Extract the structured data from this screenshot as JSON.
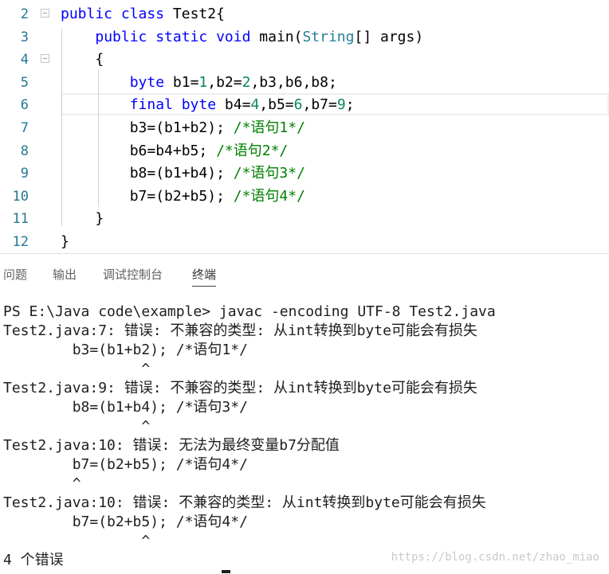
{
  "editor": {
    "lines": [
      {
        "num": "2",
        "tokens": [
          {
            "t": "public class ",
            "c": "kw"
          },
          {
            "t": "Test2{",
            "c": ""
          }
        ]
      },
      {
        "num": "3",
        "tokens": [
          {
            "t": "    ",
            "c": ""
          },
          {
            "t": "public static void ",
            "c": "kw"
          },
          {
            "t": "main(",
            "c": ""
          },
          {
            "t": "String",
            "c": "ty"
          },
          {
            "t": "[] args)",
            "c": ""
          }
        ]
      },
      {
        "num": "4",
        "tokens": [
          {
            "t": "    {",
            "c": ""
          }
        ]
      },
      {
        "num": "5",
        "tokens": [
          {
            "t": "        ",
            "c": ""
          },
          {
            "t": "byte ",
            "c": "kw"
          },
          {
            "t": "b1=",
            "c": ""
          },
          {
            "t": "1",
            "c": "num"
          },
          {
            "t": ",b2=",
            "c": ""
          },
          {
            "t": "2",
            "c": "num"
          },
          {
            "t": ",b3,b6,b8;",
            "c": ""
          }
        ]
      },
      {
        "num": "6",
        "tokens": [
          {
            "t": "        ",
            "c": ""
          },
          {
            "t": "final byte ",
            "c": "kw"
          },
          {
            "t": "b4=",
            "c": ""
          },
          {
            "t": "4",
            "c": "num"
          },
          {
            "t": ",b5=",
            "c": ""
          },
          {
            "t": "6",
            "c": "num"
          },
          {
            "t": ",b7=",
            "c": ""
          },
          {
            "t": "9",
            "c": "num"
          },
          {
            "t": ";",
            "c": ""
          }
        ]
      },
      {
        "num": "7",
        "tokens": [
          {
            "t": "        b3=(b1+b2); ",
            "c": ""
          },
          {
            "t": "/*语句1*/",
            "c": "cm"
          }
        ]
      },
      {
        "num": "8",
        "tokens": [
          {
            "t": "        b6=b4+b5; ",
            "c": ""
          },
          {
            "t": "/*语句2*/",
            "c": "cm"
          }
        ]
      },
      {
        "num": "9",
        "tokens": [
          {
            "t": "        b8=(b1+b4); ",
            "c": ""
          },
          {
            "t": "/*语句3*/",
            "c": "cm"
          }
        ]
      },
      {
        "num": "10",
        "tokens": [
          {
            "t": "        b7=(b2+b5); ",
            "c": ""
          },
          {
            "t": "/*语句4*/",
            "c": "cm"
          }
        ]
      },
      {
        "num": "11",
        "tokens": [
          {
            "t": "    }",
            "c": ""
          }
        ]
      },
      {
        "num": "12",
        "tokens": [
          {
            "t": "}",
            "c": ""
          }
        ]
      }
    ],
    "fold_markers_on_lines": [
      "2",
      "4"
    ]
  },
  "panel": {
    "tabs": [
      "问题",
      "输出",
      "调试控制台",
      "终端"
    ],
    "active_tab": "终端"
  },
  "terminal": {
    "lines": [
      "PS E:\\Java code\\example> javac -encoding UTF-8 Test2.java",
      "Test2.java:7: 错误: 不兼容的类型: 从int转换到byte可能会有损失",
      "        b3=(b1+b2); /*语句1*/",
      "                ^",
      "Test2.java:9: 错误: 不兼容的类型: 从int转换到byte可能会有损失",
      "        b8=(b1+b4); /*语句3*/",
      "                ^",
      "Test2.java:10: 错误: 无法为最终变量b7分配值",
      "        b7=(b2+b5); /*语句4*/",
      "        ^",
      "Test2.java:10: 错误: 不兼容的类型: 从int转换到byte可能会有损失",
      "        b7=(b2+b5); /*语句4*/",
      "                ^",
      "4 个错误"
    ]
  },
  "watermark": "https://blog.csdn.net/zhao_miao",
  "colors": {
    "keyword": "#0000ff",
    "type": "#267f99",
    "number": "#09885a",
    "comment": "#008000",
    "line_number": "#237893"
  }
}
